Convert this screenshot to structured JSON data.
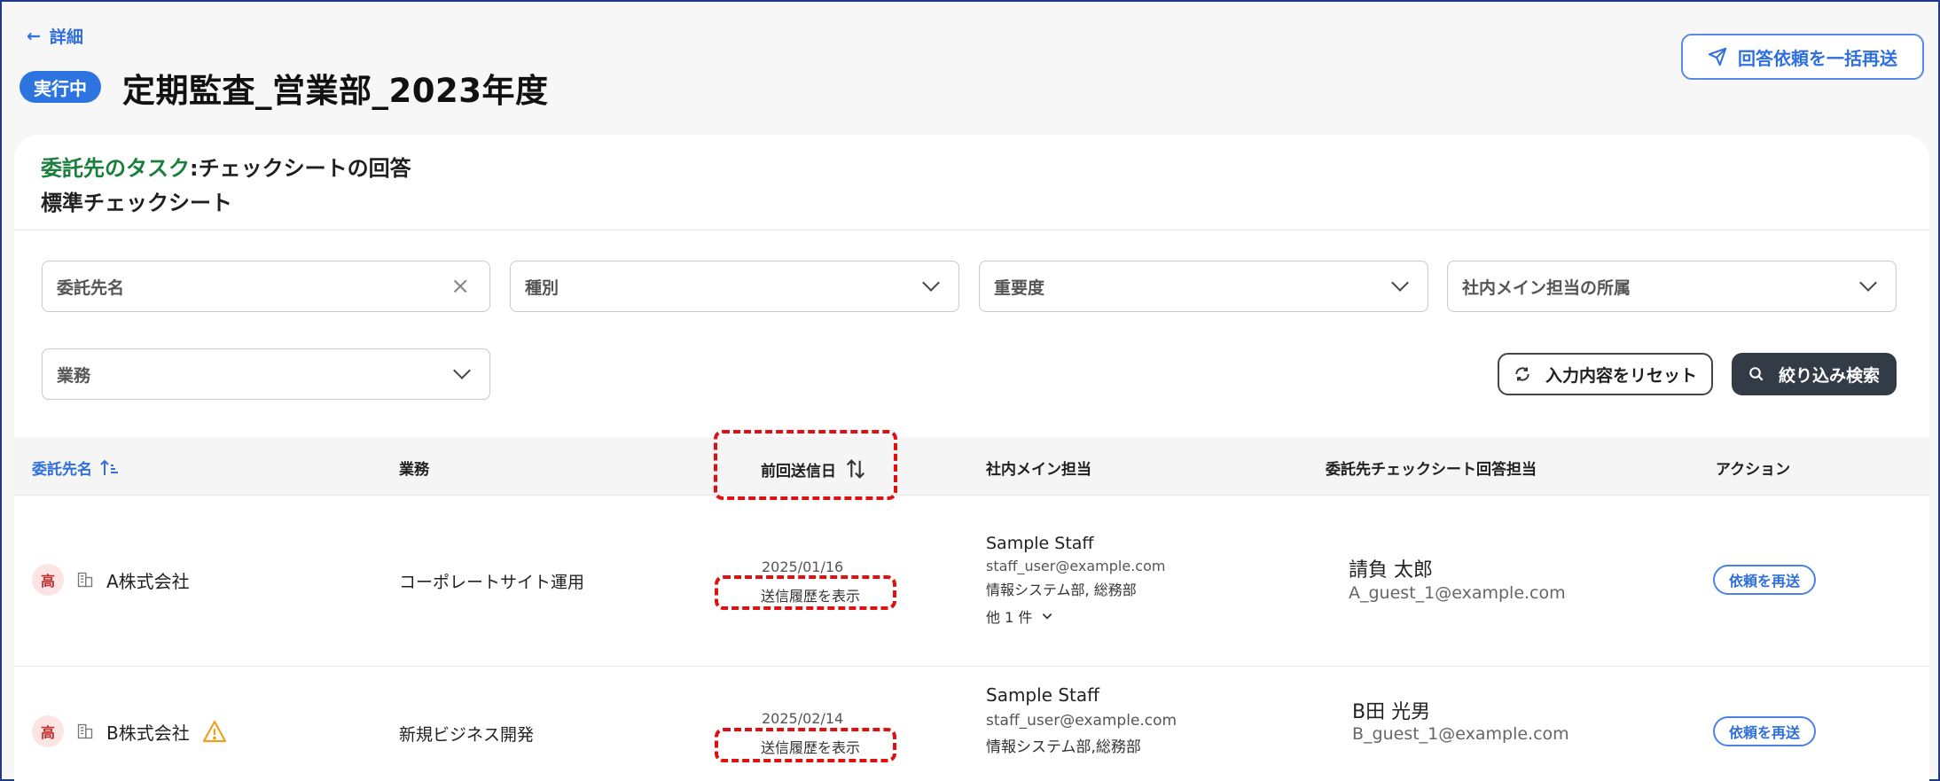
{
  "header": {
    "back_label": "詳細",
    "status": "実行中",
    "title": "定期監査_営業部_2023年度",
    "resend_all_label": "回答依頼を一括再送"
  },
  "task": {
    "prefix": "委託先のタスク",
    "separator": ":",
    "name": "チェックシートの回答",
    "sheet": "標準チェックシート"
  },
  "filters": {
    "vendor_name": "委託先名",
    "type": "種別",
    "importance": "重要度",
    "internal_dept": "社内メイン担当の所属",
    "business": "業務",
    "reset_label": "入力内容をリセット",
    "search_label": "絞り込み検索"
  },
  "table": {
    "headers": {
      "vendor": "委託先名",
      "business": "業務",
      "last_sent": "前回送信日",
      "internal_main": "社内メイン担当",
      "respondent": "委託先チェックシート回答担当",
      "action": "アクション"
    },
    "rows": [
      {
        "priority": "高",
        "company": "A株式会社",
        "business": "コーポレートサイト運用",
        "last_sent": "2025/01/16",
        "history_label": "送信履歴を表示",
        "staff_name": "Sample Staff",
        "staff_email": "staff_user@example.com",
        "staff_dept": "情報システム部, 総務部",
        "more_label": "他 1 件",
        "respondent_name": "請負 太郎",
        "respondent_email": "A_guest_1@example.com",
        "action_label": "依頼を再送"
      },
      {
        "priority": "高",
        "company": "B株式会社",
        "business": "新規ビジネス開発",
        "last_sent": "2025/02/14",
        "history_label": "送信履歴を表示",
        "staff_name": "Sample Staff",
        "staff_email": "staff_user@example.com",
        "staff_dept": "情報システム部,総務部",
        "respondent_name": "B田 光男",
        "respondent_email": "B_guest_1@example.com",
        "action_label": "依頼を再送"
      }
    ]
  },
  "colors": {
    "accent": "#2f6fde",
    "task_green": "#1a7f3c",
    "warning": "#f0a020",
    "highlight": "#e01010"
  }
}
